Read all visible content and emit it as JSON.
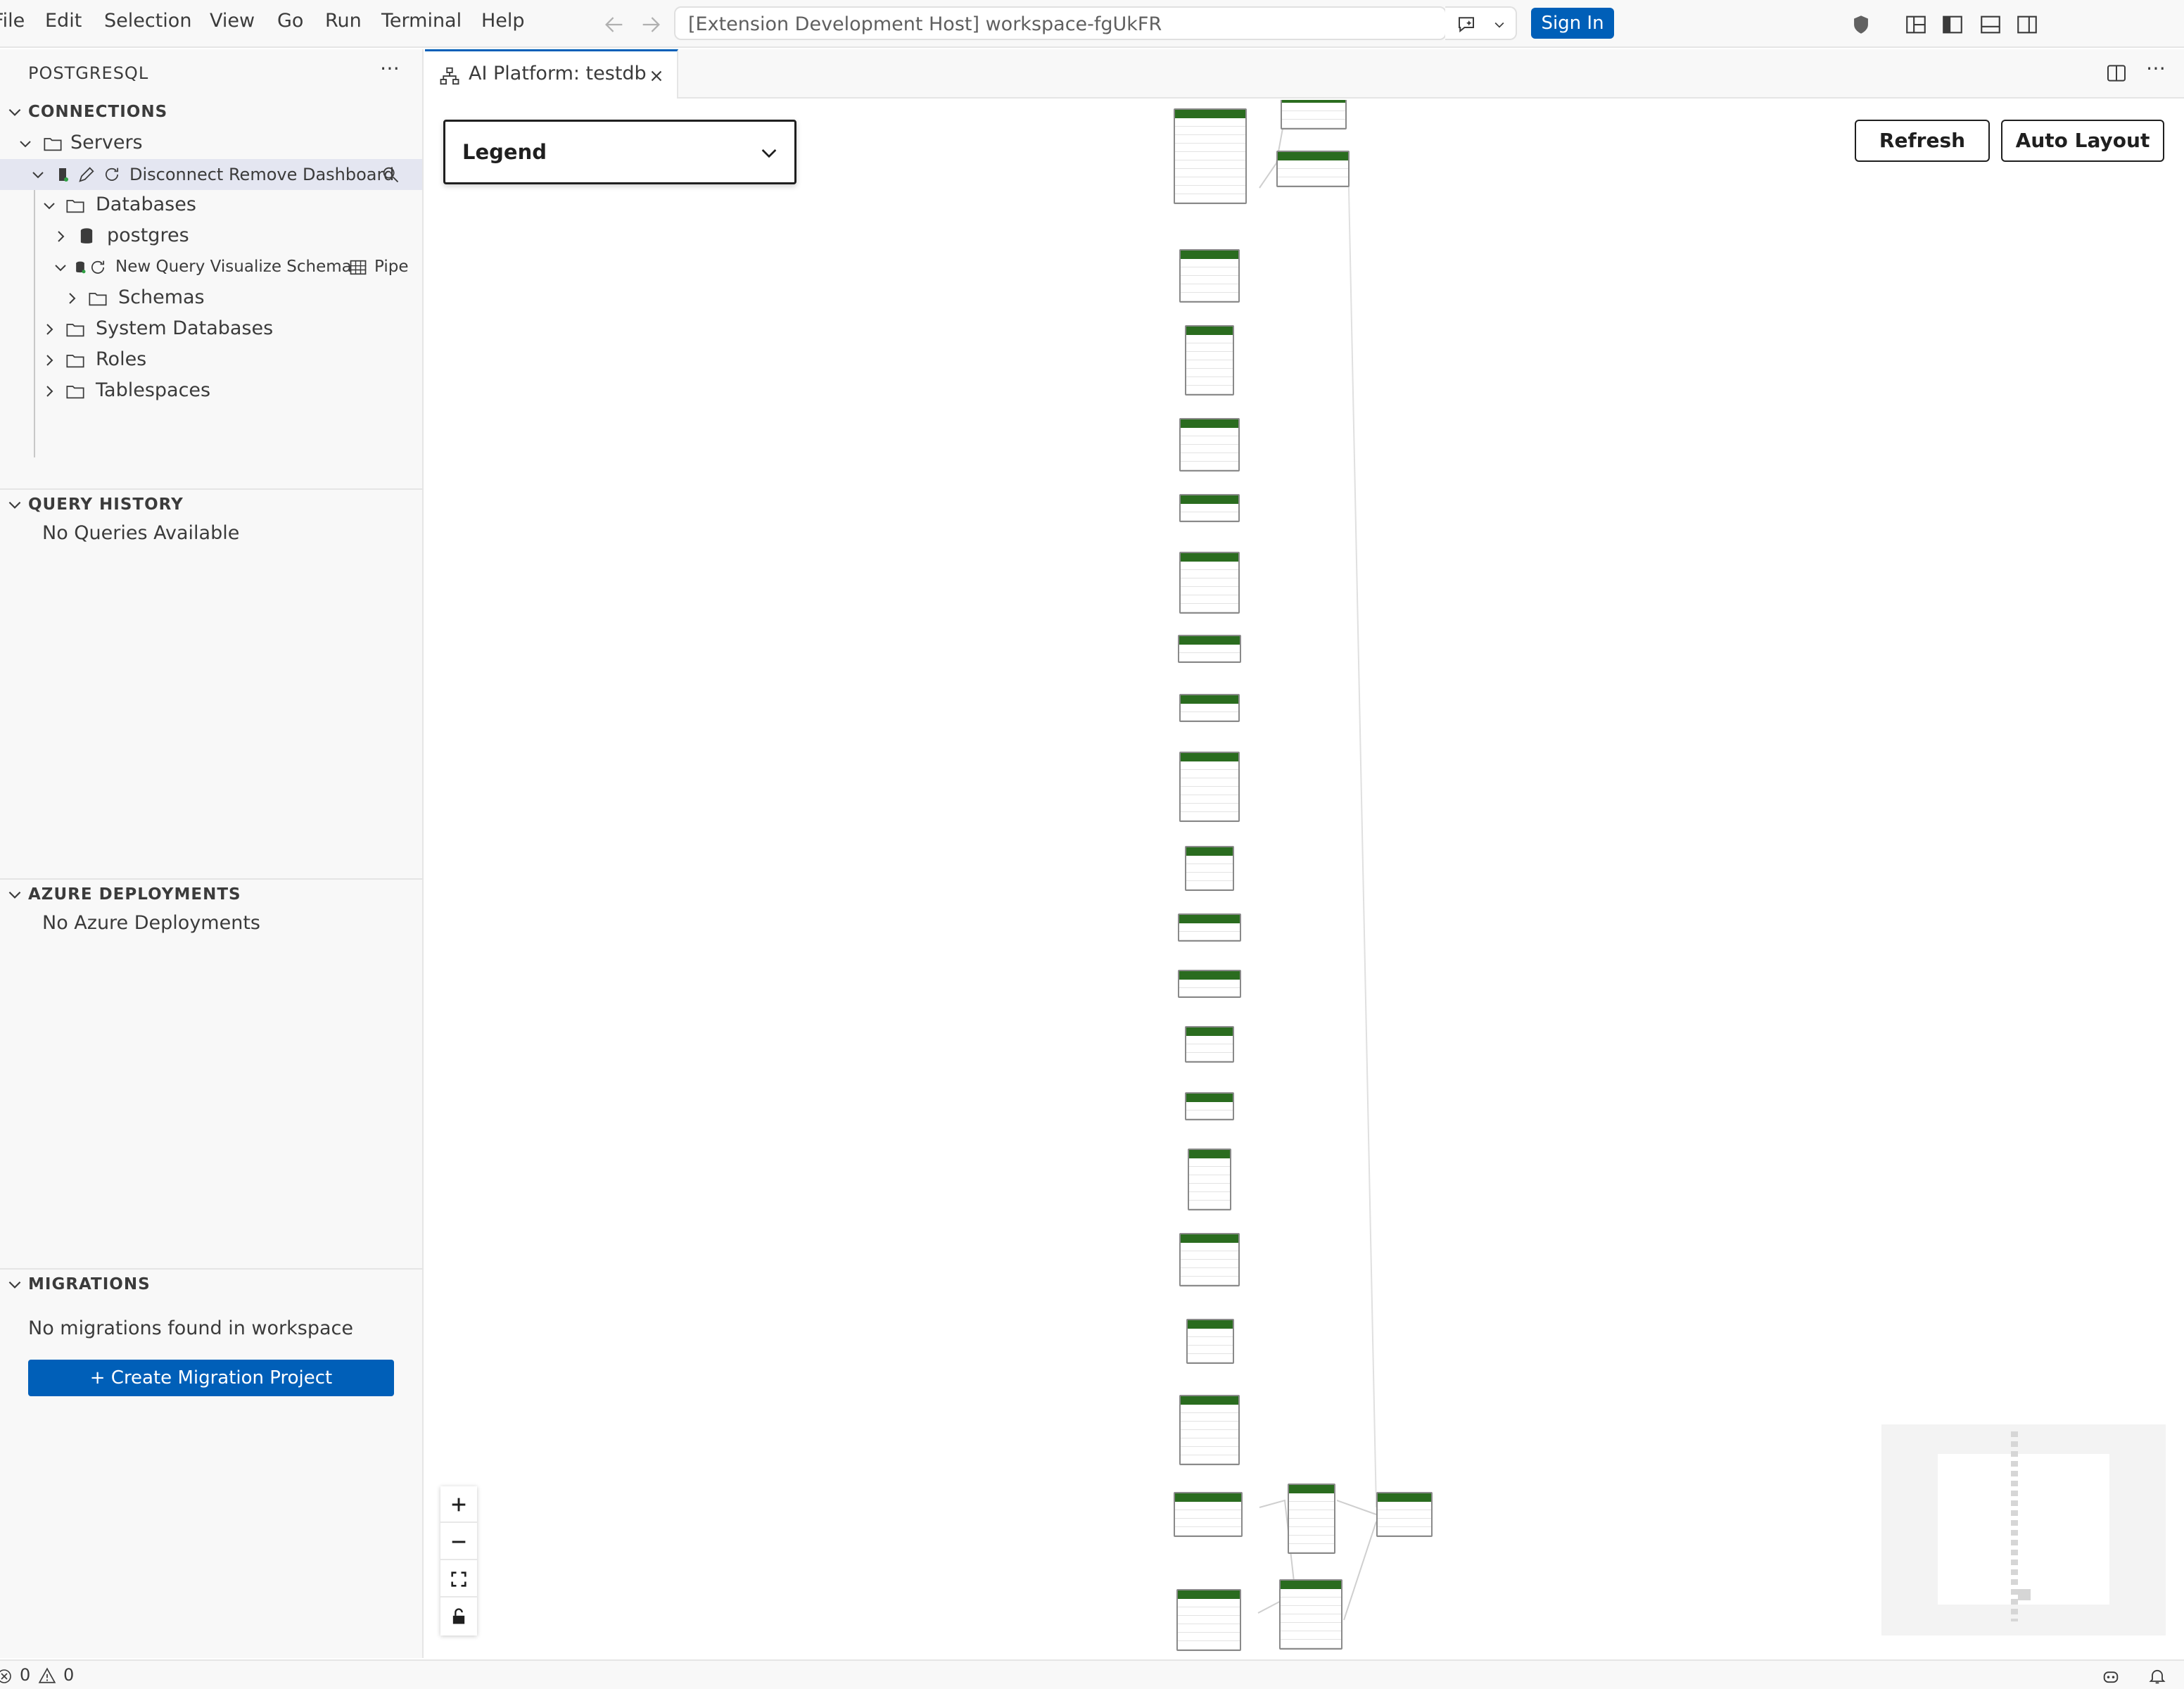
{
  "menu": [
    "File",
    "Edit",
    "Selection",
    "View",
    "Go",
    "Run",
    "Terminal",
    "Help"
  ],
  "command_center": {
    "text": "[Extension Development Host] workspace-fgUkFR"
  },
  "titlebar": {
    "sign_in": "Sign In"
  },
  "sidebar": {
    "title": "POSTGRESQL",
    "connections": {
      "header": "CONNECTIONS",
      "servers": "Servers",
      "server_actions": "Disconnect Remove Dashboard",
      "databases": "Databases",
      "postgres": "postgres",
      "db_actions": "New Query Visualize Schema",
      "db_actions_more": "Pipe",
      "schemas": "Schemas",
      "system_databases": "System Databases",
      "roles": "Roles",
      "tablespaces": "Tablespaces"
    },
    "query_history": {
      "header": "QUERY HISTORY",
      "empty": "No Queries Available"
    },
    "azure": {
      "header": "AZURE DEPLOYMENTS",
      "empty": "No Azure Deployments"
    },
    "migrations": {
      "header": "MIGRATIONS",
      "empty": "No migrations found in workspace",
      "create_button": "+ Create Migration Project"
    }
  },
  "editor": {
    "tab_title": "AI Platform: testdb",
    "legend": "Legend",
    "refresh": "Refresh",
    "auto_layout": "Auto Layout"
  },
  "statusbar": {
    "errors": "0",
    "warnings": "0"
  },
  "colors": {
    "accent": "#005fb8",
    "table_header": "#2a6c1f",
    "sidebar_bg": "#f8f8f8"
  }
}
